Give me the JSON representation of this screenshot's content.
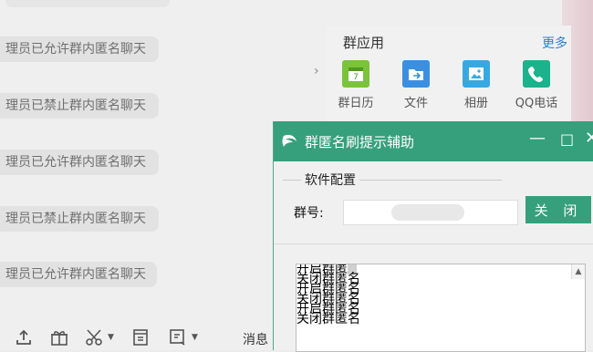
{
  "chat": {
    "notices": [
      "理员已允许群内匿名聊天",
      "理员已禁止群内匿名聊天",
      "理员已允许群内匿名聊天",
      "理员已禁止群内匿名聊天",
      "理员已允许群内匿名聊天"
    ]
  },
  "group_apps": {
    "title": "群应用",
    "more": "更多",
    "items": [
      {
        "label": "群日历",
        "icon": "calendar-icon",
        "color": "#7ac33a"
      },
      {
        "label": "文件",
        "icon": "file-icon",
        "color": "#3b8fe0"
      },
      {
        "label": "相册",
        "icon": "photo-icon",
        "color": "#36a9e0"
      },
      {
        "label": "QQ电话",
        "icon": "phone-icon",
        "color": "#1ab38b"
      }
    ]
  },
  "toolbar": {
    "message_record": "消息"
  },
  "dialog": {
    "title": "群匿名刷提示辅助",
    "section": "软件配置",
    "group_label": "群号:",
    "close_button": "关 闭",
    "log_lines": [
      "开启群匿",
      "关闭群匿名",
      "开启群匿名",
      "关闭群匿名",
      "开启群匿名",
      "关闭群匿名"
    ]
  },
  "colors": {
    "accent": "#36a07d",
    "link": "#2a80d8"
  }
}
